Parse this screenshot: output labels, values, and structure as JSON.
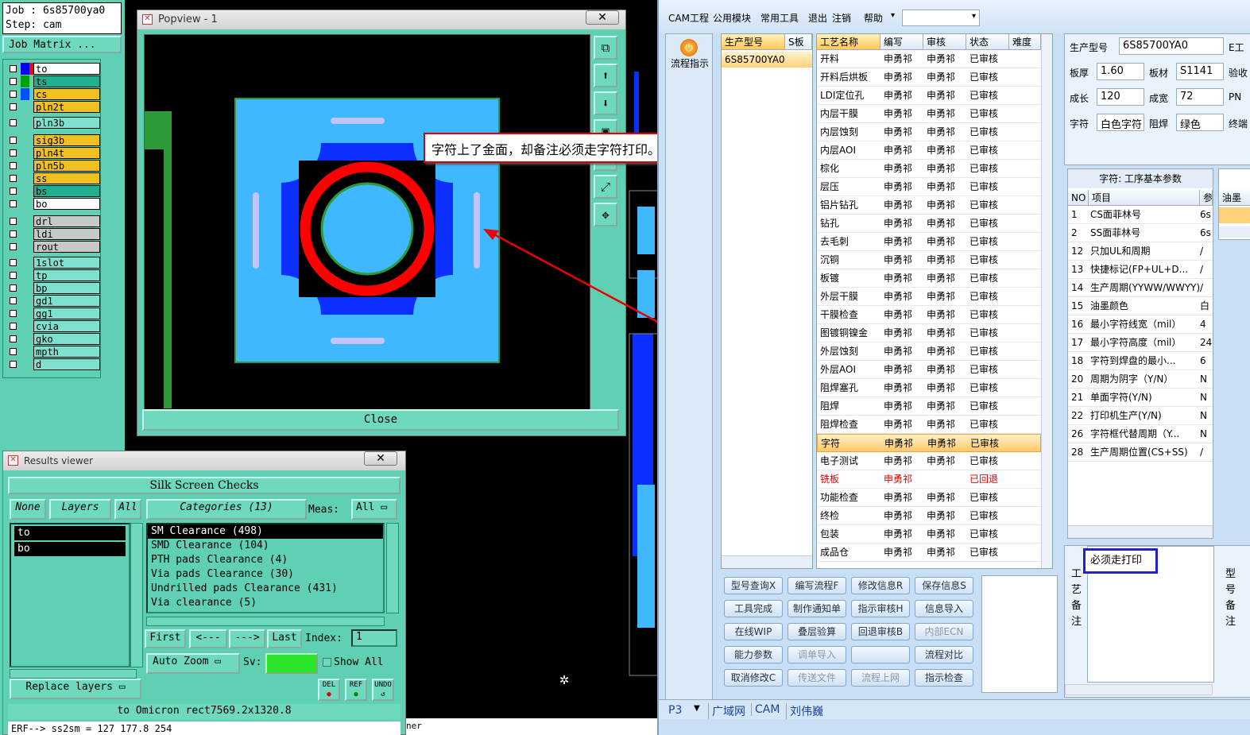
{
  "job": {
    "job_line": "Job : 6s85700ya0",
    "step_line": "Step: cam",
    "matrix_button": "Job Matrix ..."
  },
  "layers": [
    {
      "name": "to",
      "color": "#ffffff",
      "swatch": "#0000ff",
      "swatch2": "#ff0000"
    },
    {
      "name": "ts",
      "color": "#20b090",
      "swatch": "#00a000"
    },
    {
      "name": "cs",
      "color": "#f0c020",
      "swatch": "#0050ff"
    },
    {
      "name": "pln2t",
      "color": "#f0c020",
      "swatch": ""
    },
    {
      "name": "pln3b",
      "color": "#7fe0d0",
      "swatch": ""
    },
    {
      "name": "sig3b",
      "color": "#f0c020",
      "swatch": ""
    },
    {
      "name": "pln4t",
      "color": "#f0c020",
      "swatch": ""
    },
    {
      "name": "pln5b",
      "color": "#f0c020",
      "swatch": ""
    },
    {
      "name": "ss",
      "color": "#f0c020",
      "swatch": ""
    },
    {
      "name": "bs",
      "color": "#20b090",
      "swatch": ""
    },
    {
      "name": "bo",
      "color": "#ffffff",
      "swatch": ""
    },
    {
      "name": "drl",
      "color": "#c8c8c8",
      "swatch": ""
    },
    {
      "name": "ldi",
      "color": "#c8c8c8",
      "swatch": ""
    },
    {
      "name": "rout",
      "color": "#c8c8c8",
      "swatch": ""
    },
    {
      "name": "1slot",
      "color": "#7fe0d0",
      "swatch": ""
    },
    {
      "name": "tp",
      "color": "#7fe0d0",
      "swatch": ""
    },
    {
      "name": "bp",
      "color": "#7fe0d0",
      "swatch": ""
    },
    {
      "name": "gd1",
      "color": "#7fe0d0",
      "swatch": ""
    },
    {
      "name": "gg1",
      "color": "#7fe0d0",
      "swatch": ""
    },
    {
      "name": "cvia",
      "color": "#7fe0d0",
      "swatch": ""
    },
    {
      "name": "gko",
      "color": "#7fe0d0",
      "swatch": ""
    },
    {
      "name": "mpth",
      "color": "#7fe0d0",
      "swatch": ""
    },
    {
      "name": "d",
      "color": "#7fe0d0",
      "swatch": ""
    }
  ],
  "popview": {
    "title": "Popview - 1",
    "close_label": "Close",
    "close_x": "✕",
    "callout": "字符上了金面，却备注必须走字符打印。"
  },
  "results": {
    "title": "Results viewer",
    "close_x": "✕",
    "header": "Silk Screen Checks",
    "none_btn": "None",
    "layers_btn": "Layers",
    "all_btn": "All",
    "categories_btn": "Categories (13)",
    "meas_label": "Meas:",
    "meas_value": "All",
    "layer_items": [
      "to",
      "bo"
    ],
    "category_items": [
      "SM Clearance (498)",
      "SMD Clearance (104)",
      "PTH pads Clearance (4)",
      "Via pads Clearance (30)",
      "Undrilled pads Clearance (431)",
      "Via clearance (5)"
    ],
    "first": "First",
    "prev": "<---",
    "next": "--->",
    "last": "Last",
    "index_label": "Index:",
    "index_value": "1",
    "autozoom": "Auto Zoom",
    "sv_label": "Sv:",
    "show_all": "Show All",
    "replace": "Replace layers",
    "del": "DEL",
    "ref": "REF",
    "undo": "UNDO",
    "status1": "to Omicron  rect7569.2x1320.8",
    "status2": "ERF--> ss2sm = 127 177.8 254",
    "behind_text": "ner"
  },
  "cam": {
    "menus": [
      "CAM工程",
      "公用模块",
      "常用工具",
      "退出",
      "注销",
      "帮助"
    ],
    "flow_button": "流程指示",
    "model_headers": [
      "生产型号",
      "S板"
    ],
    "model_value": "6S85700YA0",
    "proc_headers": [
      "工艺名称",
      "编写",
      "审核",
      "状态",
      "难度"
    ],
    "processes": [
      {
        "name": "开料",
        "writer": "申勇祁",
        "reviewer": "申勇祁",
        "status": "已审核"
      },
      {
        "name": "开料后烘板",
        "writer": "申勇祁",
        "reviewer": "申勇祁",
        "status": "已审核"
      },
      {
        "name": "LDI定位孔",
        "writer": "申勇祁",
        "reviewer": "申勇祁",
        "status": "已审核"
      },
      {
        "name": "内层干膜",
        "writer": "申勇祁",
        "reviewer": "申勇祁",
        "status": "已审核"
      },
      {
        "name": "内层蚀刻",
        "writer": "申勇祁",
        "reviewer": "申勇祁",
        "status": "已审核"
      },
      {
        "name": "内层AOI",
        "writer": "申勇祁",
        "reviewer": "申勇祁",
        "status": "已审核"
      },
      {
        "name": "棕化",
        "writer": "申勇祁",
        "reviewer": "申勇祁",
        "status": "已审核"
      },
      {
        "name": "层压",
        "writer": "申勇祁",
        "reviewer": "申勇祁",
        "status": "已审核"
      },
      {
        "name": "铝片钻孔",
        "writer": "申勇祁",
        "reviewer": "申勇祁",
        "status": "已审核"
      },
      {
        "name": "钻孔",
        "writer": "申勇祁",
        "reviewer": "申勇祁",
        "status": "已审核"
      },
      {
        "name": "去毛刺",
        "writer": "申勇祁",
        "reviewer": "申勇祁",
        "status": "已审核"
      },
      {
        "name": "沉铜",
        "writer": "申勇祁",
        "reviewer": "申勇祁",
        "status": "已审核"
      },
      {
        "name": "板镀",
        "writer": "申勇祁",
        "reviewer": "申勇祁",
        "status": "已审核"
      },
      {
        "name": "外层干膜",
        "writer": "申勇祁",
        "reviewer": "申勇祁",
        "status": "已审核"
      },
      {
        "name": "干膜检查",
        "writer": "申勇祁",
        "reviewer": "申勇祁",
        "status": "已审核"
      },
      {
        "name": "图镀铜镍金",
        "writer": "申勇祁",
        "reviewer": "申勇祁",
        "status": "已审核"
      },
      {
        "name": "外层蚀刻",
        "writer": "申勇祁",
        "reviewer": "申勇祁",
        "status": "已审核"
      },
      {
        "name": "外层AOI",
        "writer": "申勇祁",
        "reviewer": "申勇祁",
        "status": "已审核"
      },
      {
        "name": "阻焊塞孔",
        "writer": "申勇祁",
        "reviewer": "申勇祁",
        "status": "已审核"
      },
      {
        "name": "阻焊",
        "writer": "申勇祁",
        "reviewer": "申勇祁",
        "status": "已审核"
      },
      {
        "name": "阻焊检查",
        "writer": "申勇祁",
        "reviewer": "申勇祁",
        "status": "已审核"
      },
      {
        "name": "字符",
        "writer": "申勇祁",
        "reviewer": "申勇祁",
        "status": "已审核",
        "selected": true
      },
      {
        "name": "电子测试",
        "writer": "申勇祁",
        "reviewer": "申勇祁",
        "status": "已审核"
      },
      {
        "name": "铣板",
        "writer": "申勇祁",
        "reviewer": "",
        "status": "已回退",
        "red": true
      },
      {
        "name": "功能检查",
        "writer": "申勇祁",
        "reviewer": "申勇祁",
        "status": "已审核"
      },
      {
        "name": "终检",
        "writer": "申勇祁",
        "reviewer": "申勇祁",
        "status": "已审核"
      },
      {
        "name": "包装",
        "writer": "申勇祁",
        "reviewer": "申勇祁",
        "status": "已审核"
      },
      {
        "name": "成品仓",
        "writer": "申勇祁",
        "reviewer": "申勇祁",
        "status": "已审核"
      }
    ],
    "buttons": [
      {
        "label": "型号查询X",
        "enabled": true
      },
      {
        "label": "编写流程F",
        "enabled": true
      },
      {
        "label": "修改信息R",
        "enabled": true
      },
      {
        "label": "保存信息S",
        "enabled": true
      },
      {
        "label": "工具完成",
        "enabled": true
      },
      {
        "label": "制作通知单",
        "enabled": true
      },
      {
        "label": "指示审核H",
        "enabled": true
      },
      {
        "label": "信息导入",
        "enabled": true
      },
      {
        "label": "在线WIP",
        "enabled": true
      },
      {
        "label": "叠层验算",
        "enabled": true
      },
      {
        "label": "回退审核B",
        "enabled": true
      },
      {
        "label": "内部ECN",
        "enabled": false
      },
      {
        "label": "能力参数",
        "enabled": true
      },
      {
        "label": "调单导入",
        "enabled": false
      },
      {
        "label": "",
        "enabled": true
      },
      {
        "label": "流程对比",
        "enabled": true
      },
      {
        "label": "取消修改C",
        "enabled": true
      },
      {
        "label": "传送文件",
        "enabled": false
      },
      {
        "label": "流程上网",
        "enabled": false
      },
      {
        "label": "指示检查",
        "enabled": true
      }
    ],
    "info": {
      "model_label": "生产型号",
      "model_value": "6S85700YA0",
      "e_label": "E工",
      "thick_label": "板厚",
      "thick_value": "1.60",
      "mat_label": "板材",
      "mat_value": "S1141",
      "check_label": "验收",
      "len_label": "成长",
      "len_value": "120",
      "wid_label": "成宽",
      "wid_value": "72",
      "pn_label": "PN",
      "char_label": "字符",
      "char_value": "白色字符",
      "mask_label": "阻焊",
      "mask_value": "绿色",
      "end_label": "终端"
    },
    "params_title": "字符: 工序基本参数",
    "params_headers": [
      "NO",
      "项目",
      "参"
    ],
    "params": [
      {
        "no": "1",
        "item": "CS面菲林号",
        "val": "6s"
      },
      {
        "no": "2",
        "item": "SS面菲林号",
        "val": "6s"
      },
      {
        "no": "12",
        "item": "只加UL和周期",
        "val": "/"
      },
      {
        "no": "13",
        "item": "快捷标记(FP+UL+D...",
        "val": "/"
      },
      {
        "no": "14",
        "item": "生产周期(YYWW/WWYY)",
        "val": "/"
      },
      {
        "no": "15",
        "item": "油墨颜色",
        "val": "白"
      },
      {
        "no": "16",
        "item": "最小字符线宽（mil）",
        "val": "4"
      },
      {
        "no": "17",
        "item": "最小字符高度（mil）",
        "val": "24"
      },
      {
        "no": "18",
        "item": "字符到焊盘的最小...",
        "val": "6"
      },
      {
        "no": "20",
        "item": "周期为阴字（Y/N）",
        "val": "N"
      },
      {
        "no": "21",
        "item": "单面字符(Y/N)",
        "val": "N"
      },
      {
        "no": "22",
        "item": "打印机生产(Y/N)",
        "val": "N"
      },
      {
        "no": "26",
        "item": "字符框代替周期（Y...",
        "val": "N"
      },
      {
        "no": "28",
        "item": "生产周期位置(CS+SS)",
        "val": "/"
      }
    ],
    "side_header": "油墨",
    "note_label": "工艺备注",
    "note_value": "必须走打印",
    "side_label2": "型号备注",
    "status": {
      "p3": "P3",
      "net": "广域网",
      "cam": "CAM",
      "user": "刘伟巍"
    }
  }
}
